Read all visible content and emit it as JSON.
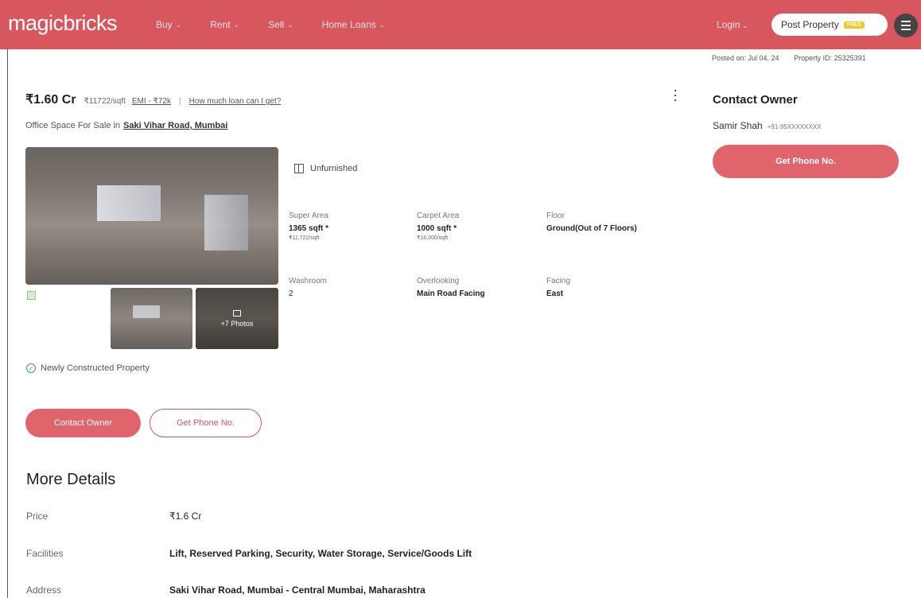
{
  "header": {
    "logo": "magicbricks",
    "nav": [
      {
        "label": "Buy"
      },
      {
        "label": "Rent"
      },
      {
        "label": "Sell"
      },
      {
        "label": "Home Loans"
      }
    ],
    "login": "Login",
    "post_property": "Post Property",
    "free_badge": "FREE"
  },
  "meta": {
    "posted_on": "Posted on: Jul 04, 24",
    "property_id": "Property ID: 25325391"
  },
  "listing": {
    "price": "₹1.60 Cr",
    "price_per_sqft": "₹11722/sqft",
    "emi": "EMI - ₹72k",
    "separator": "|",
    "loan_link": "How much loan can I get?",
    "title_prefix": "Office Space For Sale in",
    "location": "Saki Vihar Road, Mumbai",
    "photos_more": "+7 Photos",
    "furnishing": "Unfurnished",
    "specs": {
      "super_area": {
        "label": "Super Area",
        "value": "1365 sqft",
        "sub": "₹11,722/sqft"
      },
      "carpet_area": {
        "label": "Carpet Area",
        "value": "1000 sqft",
        "sub": "₹16,000/sqft"
      },
      "floor": {
        "label": "Floor",
        "value": "Ground(Out of 7 Floors)"
      },
      "washroom": {
        "label": "Washroom",
        "value": "2"
      },
      "overlooking": {
        "label": "Overlooking",
        "value": "Main Road Facing"
      },
      "facing": {
        "label": "Facing",
        "value": "East"
      }
    },
    "newly_constructed": "Newly Constructed Property",
    "contact_owner_btn": "Contact Owner",
    "get_phone_btn": "Get Phone No."
  },
  "more_details": {
    "title": "More Details",
    "rows": [
      {
        "key": "Price",
        "value": "₹1.6 Cr"
      },
      {
        "key": "Facilities",
        "value": "Lift, Reserved Parking, Security, Water Storage, Service/Goods Lift"
      },
      {
        "key": "Address",
        "value": "Saki Vihar Road, Mumbai - Central Mumbai, Maharashtra"
      }
    ]
  },
  "contact_panel": {
    "title": "Contact Owner",
    "owner_name": "Samir Shah",
    "owner_phone": "+91-95XXXXXXXX",
    "get_phone_btn": "Get Phone No."
  },
  "icons": [
    "chevron-down-icon",
    "menu-icon",
    "kebab-menu-icon",
    "furnishing-icon",
    "gallery-icon",
    "check-circle-icon",
    "broken-image-icon"
  ],
  "colors": {
    "brand": "#d8575f",
    "button": "#e0646c",
    "success": "#3aa15a"
  }
}
